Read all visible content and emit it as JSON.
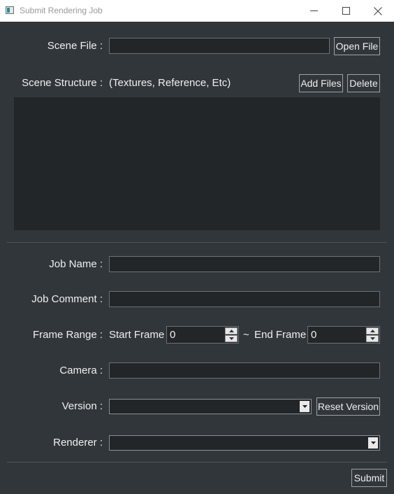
{
  "window": {
    "title": "Submit Rendering Job"
  },
  "scene_file": {
    "label": "Scene File :",
    "value": "",
    "open_label": "Open File"
  },
  "scene_structure": {
    "label": "Scene Structure :",
    "hint": "(Textures, Reference, Etc)",
    "add_label": "Add Files",
    "delete_label": "Delete",
    "items": []
  },
  "job_name": {
    "label": "Job Name :",
    "value": ""
  },
  "job_comment": {
    "label": "Job Comment :",
    "value": ""
  },
  "frame_range": {
    "label": "Frame Range :",
    "start_label": "Start Frame",
    "start_value": "0",
    "separator": "~",
    "end_label": "End Frame",
    "end_value": "0"
  },
  "camera": {
    "label": "Camera :",
    "value": ""
  },
  "version": {
    "label": "Version :",
    "selected": "",
    "reset_label": "Reset Version"
  },
  "renderer": {
    "label": "Renderer :",
    "selected": ""
  },
  "footer": {
    "submit_label": "Submit"
  },
  "colors": {
    "background": "#31363b",
    "field": "#232629",
    "border": "#6b7076",
    "text": "#eff0f1"
  }
}
